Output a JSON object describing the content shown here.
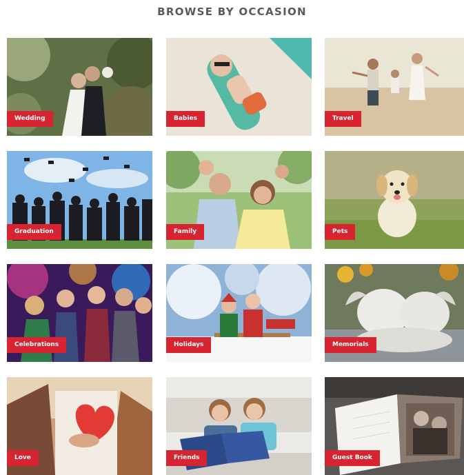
{
  "section": {
    "title": "BROWSE BY OCCASION"
  },
  "occasions": [
    {
      "label": "Wedding",
      "icon": "wedding-photo"
    },
    {
      "label": "Babies",
      "icon": "baby-photo"
    },
    {
      "label": "Travel",
      "icon": "beach-family-photo"
    },
    {
      "label": "Graduation",
      "icon": "graduation-caps-photo"
    },
    {
      "label": "Family",
      "icon": "family-photo"
    },
    {
      "label": "Pets",
      "icon": "puppy-photo"
    },
    {
      "label": "Celebrations",
      "icon": "party-photo"
    },
    {
      "label": "Holidays",
      "icon": "snow-sled-photo"
    },
    {
      "label": "Memorials",
      "icon": "cherub-statue-photo"
    },
    {
      "label": "Love",
      "icon": "heart-photo"
    },
    {
      "label": "Friends",
      "icon": "friends-reading-photo"
    },
    {
      "label": "Guest Book",
      "icon": "photo-book-photo"
    }
  ],
  "colors": {
    "label_bg": "#d82331",
    "label_text": "#ffffff",
    "heading": "#5a5a5a"
  }
}
